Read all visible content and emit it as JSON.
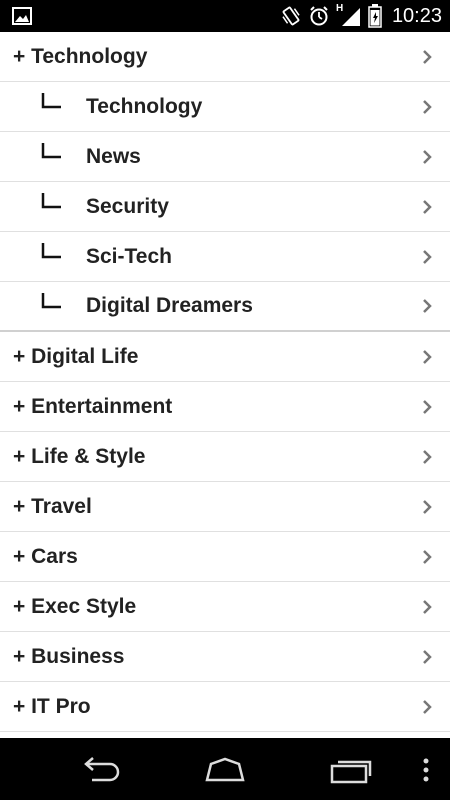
{
  "status_bar": {
    "time": "10:23",
    "icons": [
      "image-notification-icon",
      "vibrate-icon",
      "alarm-icon",
      "signal-h-icon",
      "battery-icon"
    ],
    "network_type": "H"
  },
  "categories": [
    {
      "label": "+ Technology",
      "expanded": true,
      "children": [
        {
          "label": "Technology"
        },
        {
          "label": "News"
        },
        {
          "label": "Security"
        },
        {
          "label": "Sci-Tech"
        },
        {
          "label": "Digital Dreamers"
        }
      ]
    },
    {
      "label": "+ Digital Life"
    },
    {
      "label": "+ Entertainment"
    },
    {
      "label": "+ Life & Style"
    },
    {
      "label": "+ Travel"
    },
    {
      "label": "+ Cars"
    },
    {
      "label": "+ Exec Style"
    },
    {
      "label": "+ Business"
    },
    {
      "label": "+ IT Pro"
    }
  ],
  "navigation": {
    "buttons": [
      "back-icon",
      "home-icon",
      "recent-apps-icon",
      "overflow-menu-icon"
    ]
  },
  "colors": {
    "text": "#222222",
    "divider": "#e0e0e0",
    "chevron": "#777777",
    "bar": "#000000"
  }
}
